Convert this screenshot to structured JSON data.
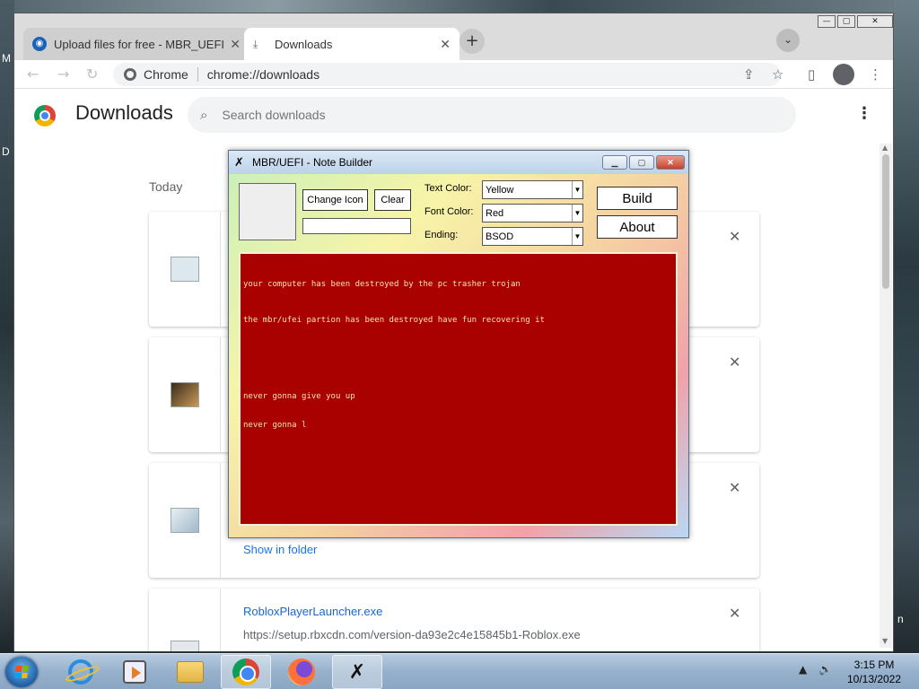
{
  "desktop": {
    "left_labels": [
      "M",
      "D"
    ],
    "right_label": "n"
  },
  "browser": {
    "tabs": [
      {
        "title": "Upload files for free - MBR_UEFI_",
        "close": "✕"
      },
      {
        "title": "Downloads",
        "close": "✕"
      }
    ],
    "new_tab": "+",
    "window_controls": [
      "—",
      "▢",
      "✕"
    ],
    "omnibox": {
      "scheme_label": "Chrome",
      "url": "chrome://downloads"
    }
  },
  "downloads": {
    "title": "Downloads",
    "search_placeholder": "Search downloads",
    "section_label": "Today",
    "items": [
      {
        "close": "✕"
      },
      {
        "close": "✕"
      },
      {
        "close": "✕",
        "action": "Show in folder"
      },
      {
        "close": "✕",
        "filename": "RobloxPlayerLauncher.exe",
        "url": "https://setup.rbxcdn.com/version-da93e2c4e15845b1-Roblox.exe"
      }
    ]
  },
  "dialog": {
    "title": "MBR/UEFI - Note Builder",
    "change_icon_label": "Change Icon",
    "clear_label": "Clear",
    "icon_path_value": "",
    "text_color_label": "Text Color:",
    "text_color_value": "Yellow",
    "font_color_label": "Font Color:",
    "font_color_value": "Red",
    "ending_label": "Ending:",
    "ending_value": "BSOD",
    "build_label": "Build",
    "about_label": "About",
    "note_lines": [
      "your computer has been destroyed by the pc trasher trojan",
      "the mbr/ufei partion has been destroyed have fun recovering it",
      "never gonna give you up",
      "never gonna l"
    ],
    "colors": {
      "note_background": "#a90000",
      "note_text": "#f4e8b0"
    }
  },
  "taskbar": {
    "clock_time": "3:15 PM",
    "clock_date": "10/13/2022"
  }
}
